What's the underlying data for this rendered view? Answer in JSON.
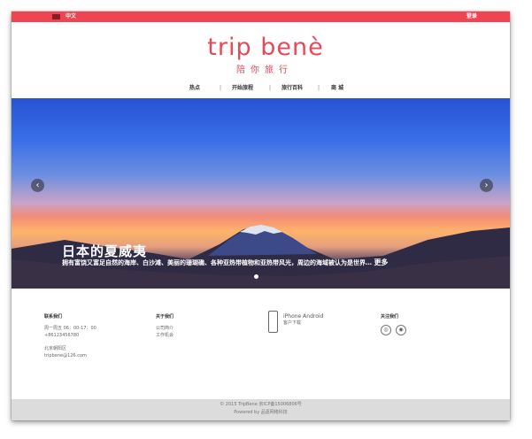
{
  "topbar": {
    "lang": "中文",
    "login": "登录"
  },
  "logo": {
    "title": "trip benè",
    "subtitle": "陪你旅行"
  },
  "nav": [
    {
      "label": "热点"
    },
    {
      "label": "开始旅程"
    },
    {
      "label": "旅行百科"
    },
    {
      "label": "商 城"
    }
  ],
  "nav_sep": "|",
  "hero": {
    "title": "日本的夏威夷",
    "description": "拥有富饶又富足自然的海岸、白沙滩、美丽的珊瑚礁、各种亚热带植物和亚热带风光，周边的海域被认为是世界…",
    "more": "更多",
    "prev": "‹",
    "next": "›"
  },
  "footer": {
    "contact": {
      "heading": "联系我们",
      "hours": "周一周五 06：00-17：00",
      "phone": "+86123456780",
      "address": "北京朝阳区",
      "email": "tripbene@126.com"
    },
    "about": {
      "heading": "关于我们",
      "links": [
        "公司简介",
        "工作机会"
      ]
    },
    "app": {
      "title": "iPhone Android",
      "sub": "客户下载"
    },
    "follow": {
      "heading": "关注我们",
      "icons": [
        "weibo-icon",
        "wechat-icon"
      ]
    }
  },
  "bottom": {
    "copyright": "© 2015 TripBene 京ICP备15006806号",
    "powered": "Powered by 品嘉网络科技"
  },
  "colors": {
    "brand": "#ef4553",
    "logo": "#e6495a"
  }
}
